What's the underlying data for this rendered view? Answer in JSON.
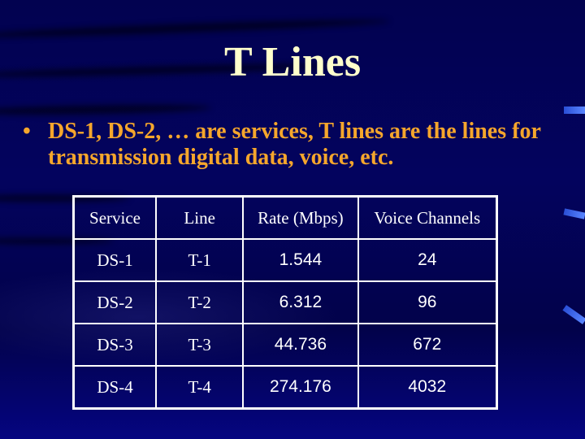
{
  "slide": {
    "title": "T Lines",
    "bullet_symbol": "•",
    "bullet_text": "DS-1, DS-2, … are services, T lines are the lines for transmission digital data, voice, etc.",
    "colors": {
      "background": "#03035e",
      "title": "#ffffcc",
      "bullet": "#f5a62c",
      "table_text": "#ffffff",
      "accent": "#3a64ea"
    }
  },
  "table": {
    "headers": [
      "Service",
      "Line",
      "Rate (Mbps)",
      "Voice Channels"
    ],
    "rows": [
      [
        "DS-1",
        "T-1",
        "1.544",
        "24"
      ],
      [
        "DS-2",
        "T-2",
        "6.312",
        "96"
      ],
      [
        "DS-3",
        "T-3",
        "44.736",
        "672"
      ],
      [
        "DS-4",
        "T-4",
        "274.176",
        "4032"
      ]
    ]
  }
}
